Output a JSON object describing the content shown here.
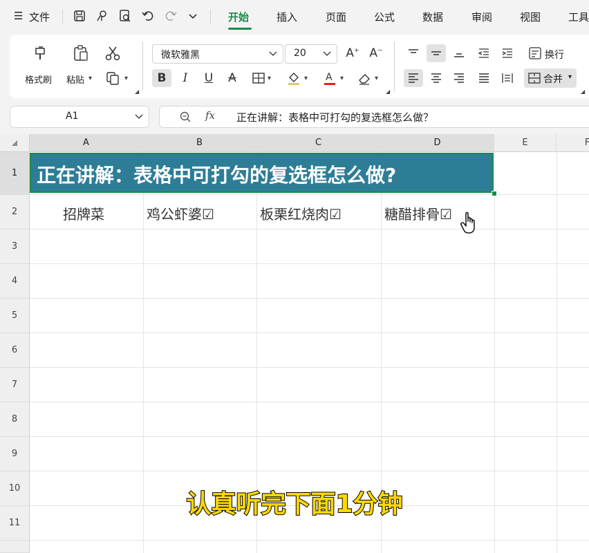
{
  "menubar": {
    "file_label": "文件",
    "tabs": [
      "开始",
      "插入",
      "页面",
      "公式",
      "数据",
      "审阅",
      "视图",
      "工具"
    ],
    "active_tab_index": 0,
    "accent_color": "#1a8a4a"
  },
  "ribbon": {
    "format_painter": "格式刷",
    "paste": "粘贴",
    "font_name": "微软雅黑",
    "font_size": "20",
    "wrap_text": "换行",
    "merge": "合并"
  },
  "formula_bar": {
    "cell_ref": "A1",
    "fx_label": "fx",
    "content": "正在讲解：表格中可打勾的复选框怎么做？"
  },
  "sheet": {
    "columns": [
      "A",
      "B",
      "C",
      "D",
      "E",
      "F"
    ],
    "rows": [
      "1",
      "2",
      "3",
      "4",
      "5",
      "6",
      "7",
      "8",
      "9",
      "10",
      "11"
    ],
    "title_cell": "正在讲解：表格中可打勾的复选框怎么做?",
    "title_fill_color": "#2e7d97",
    "row2": [
      "招牌菜",
      "鸡公虾婆☑",
      "板栗红烧肉☑",
      "糖醋排骨☑"
    ]
  },
  "subtitle": "认真听完下面1分钟"
}
